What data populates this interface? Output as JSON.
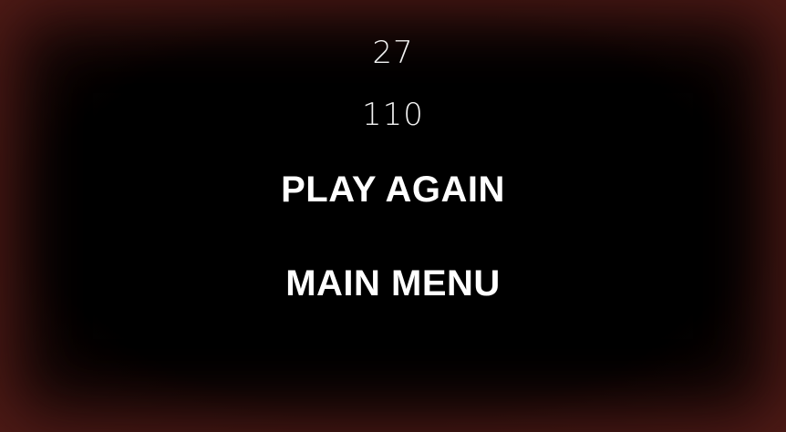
{
  "results": {
    "first_value": "27",
    "second_value": "110"
  },
  "menu": {
    "play_again_label": "PLAY AGAIN",
    "main_menu_label": "MAIN MENU"
  },
  "colors": {
    "background": "#000000",
    "text": "#ffffff",
    "edge_glow": "#5a1e1a"
  }
}
